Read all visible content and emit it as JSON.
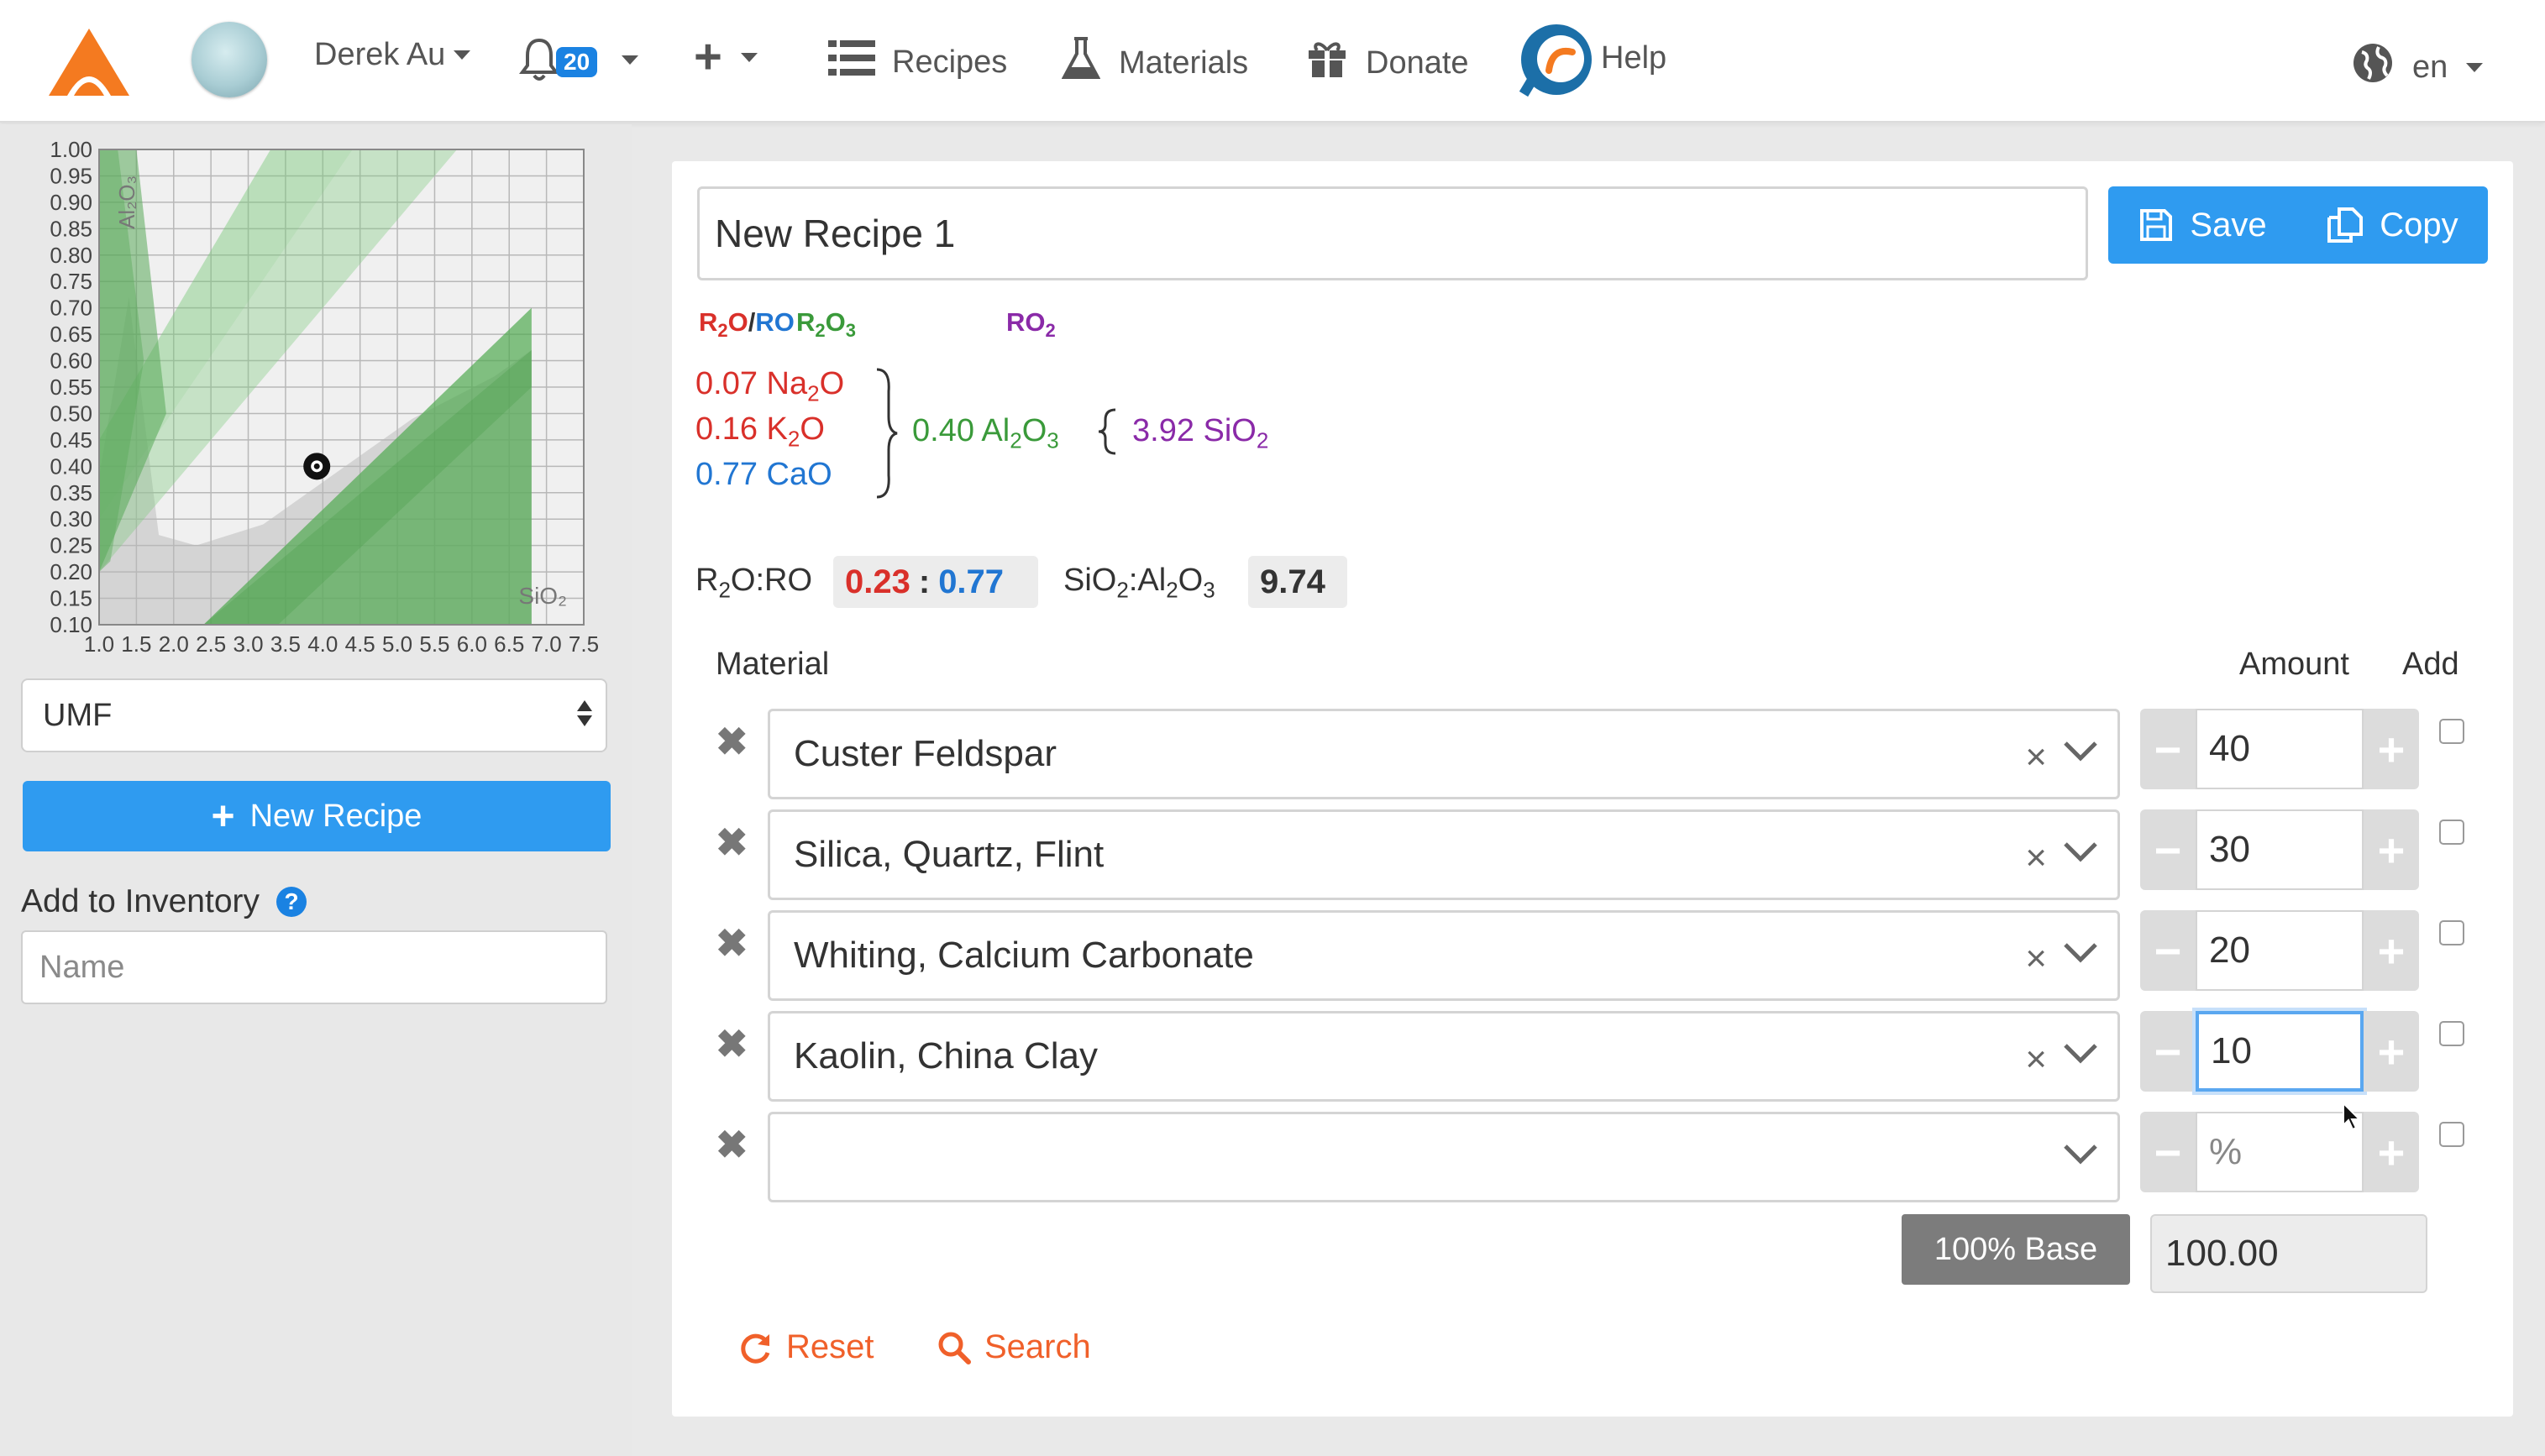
{
  "navbar": {
    "user_name": "Derek Au",
    "notification_count": "20",
    "recipes_label": "Recipes",
    "materials_label": "Materials",
    "donate_label": "Donate",
    "help_label": "Help",
    "language": "en",
    "brand_color": "#f47a20"
  },
  "sidebar": {
    "chart_data": {
      "type": "scatter",
      "xlim": [
        1.0,
        7.5
      ],
      "ylim": [
        0.1,
        1.0
      ],
      "x_tick_labels": [
        "1.0",
        "1.5",
        "2.0",
        "2.5",
        "3.0",
        "3.5",
        "4.0",
        "4.5",
        "5.0",
        "5.5",
        "6.0",
        "6.5",
        "7.0",
        "7.5"
      ],
      "y_tick_labels": [
        "1.00",
        "0.95",
        "0.90",
        "0.85",
        "0.80",
        "0.75",
        "0.70",
        "0.65",
        "0.60",
        "0.55",
        "0.50",
        "0.45",
        "0.40",
        "0.35",
        "0.30",
        "0.25",
        "0.20",
        "0.15",
        "0.10"
      ],
      "xlabel": "SiO₂",
      "ylabel": "Al₂O₃",
      "grid": true,
      "point": {
        "x": 3.92,
        "y": 0.4
      }
    },
    "mode_select": "UMF",
    "new_recipe_label": "New Recipe",
    "inventory_label": "Add to Inventory",
    "inventory_placeholder": "Name"
  },
  "recipe": {
    "title": "New Recipe 1",
    "save_label": "Save",
    "copy_label": "Copy"
  },
  "umf": {
    "flux_head_r2o": "R2O",
    "flux_head_ro": "RO",
    "r2o3_head": "R2O3",
    "ro2_head": "RO2",
    "na2o": "0.07 Na2O",
    "k2o": "0.16 K2O",
    "cao": "0.77 CaO",
    "al2o3": "0.40 Al2O3",
    "sio2": "3.92 SiO2",
    "ratio_label": "R2O:RO",
    "ratio_r2o": "0.23",
    "ratio_ro": "0.77",
    "si_al_label": "SiO2:Al2O3",
    "si_al_value": "9.74",
    "color_r2o": "#d9302a",
    "color_ro": "#2176d2",
    "color_r2o3": "#3a9a3a",
    "color_ro2": "#8a2aa8"
  },
  "table": {
    "material_header": "Material",
    "amount_header": "Amount",
    "add_header": "Add",
    "rows": [
      {
        "material": "Custer Feldspar",
        "amount": "40"
      },
      {
        "material": "Silica, Quartz, Flint",
        "amount": "30"
      },
      {
        "material": "Whiting, Calcium Carbonate",
        "amount": "20"
      },
      {
        "material": "Kaolin, China Clay",
        "amount": "10"
      },
      {
        "material": "",
        "amount": ""
      }
    ],
    "amount_placeholder": "%",
    "base_label": "100% Base",
    "total": "100.00"
  },
  "actions": {
    "reset_label": "Reset",
    "search_label": "Search"
  }
}
